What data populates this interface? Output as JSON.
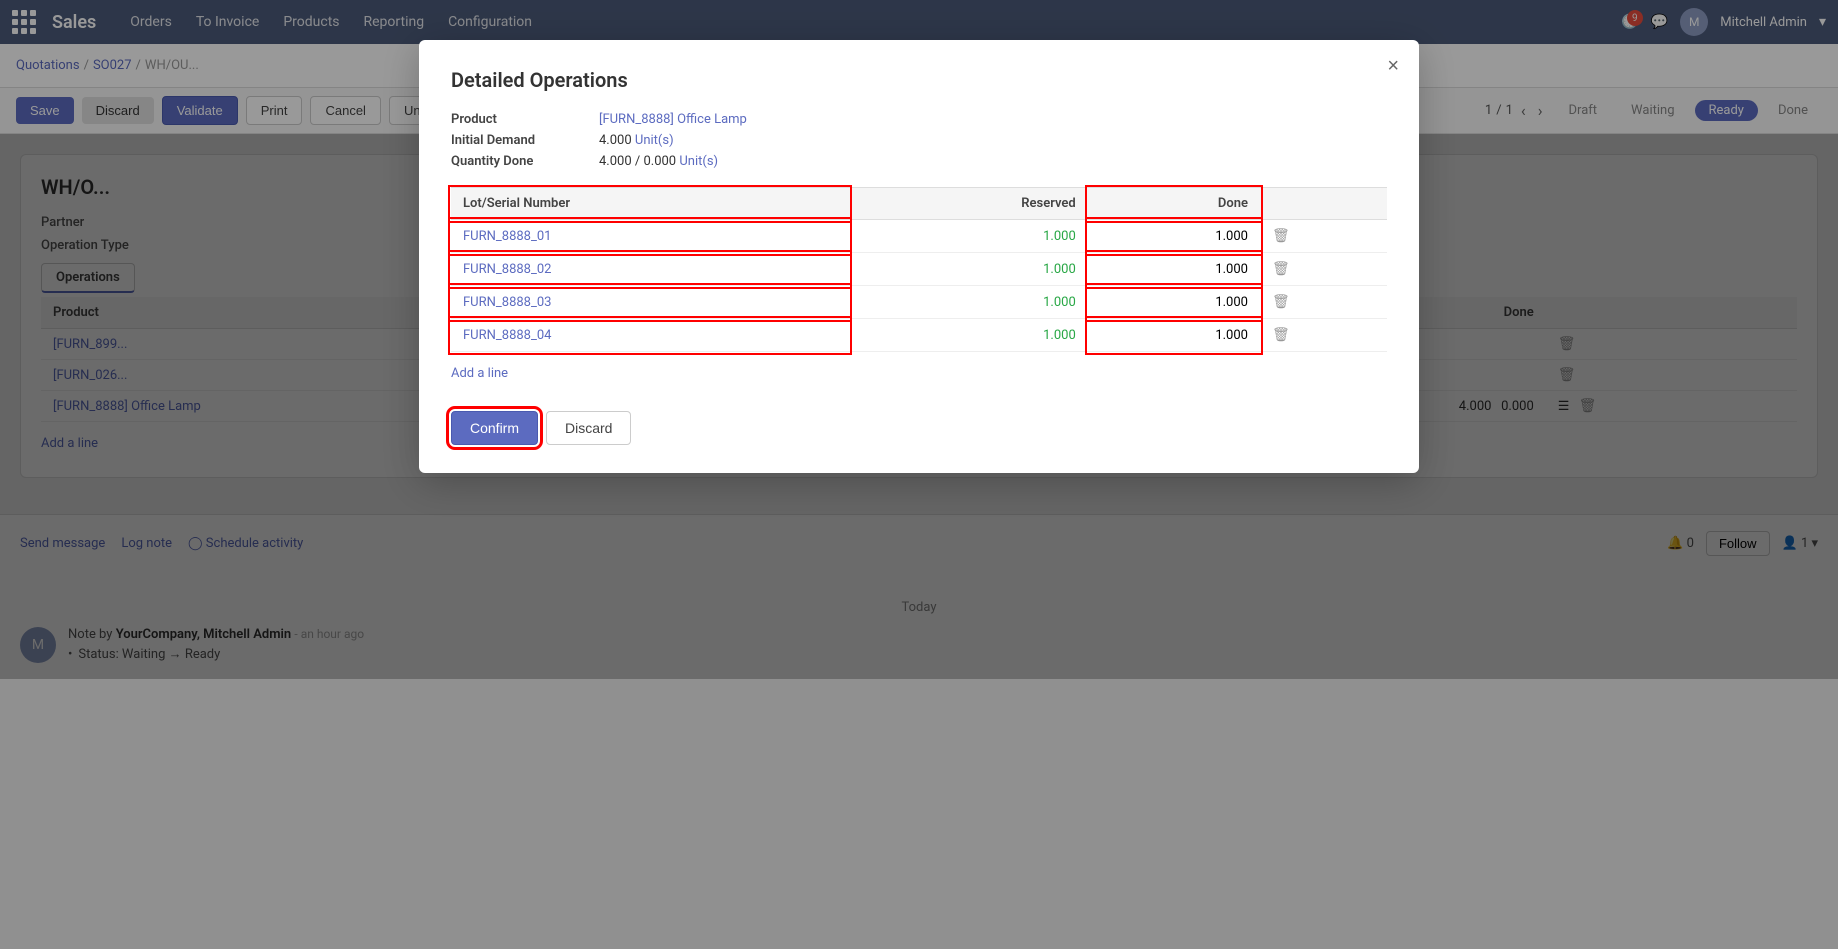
{
  "navbar": {
    "brand": "Sales",
    "menu_items": [
      "Orders",
      "To Invoice",
      "Products",
      "Reporting",
      "Configuration"
    ],
    "badge_count": "9",
    "user": "Mitchell Admin"
  },
  "breadcrumb": {
    "parts": [
      "Quotations",
      "SO027",
      "WH/OU..."
    ]
  },
  "action_bar": {
    "save_label": "Save",
    "discard_label": "Discard",
    "validate_label": "Validate",
    "print_label": "Print",
    "cancel_label": "Cancel",
    "unreserve_label": "Unreserve"
  },
  "page_nav": {
    "current": "1",
    "total": "1"
  },
  "status_items": [
    {
      "label": "Draft",
      "active": false
    },
    {
      "label": "Waiting",
      "active": false
    },
    {
      "label": "Ready",
      "active": true
    },
    {
      "label": "Done",
      "active": false
    }
  ],
  "content_title": "WH/O...",
  "form_fields": [
    {
      "label": "Partner",
      "value": ""
    },
    {
      "label": "Operation Type",
      "value": ""
    }
  ],
  "operations_tab": "Operations",
  "operations_table": {
    "headers": [
      "Product",
      "",
      "",
      "",
      "Done",
      ""
    ],
    "rows": [
      {
        "product": "[FURN_899...",
        "col2": "",
        "col3": "",
        "col4": "",
        "done": ""
      },
      {
        "product": "[FURN_026...",
        "col2": "",
        "col3": "",
        "col4": "",
        "done": ""
      },
      {
        "product": "[FURN_8888] Office Lamp",
        "col2": "",
        "col3": "",
        "col4": "4.000",
        "done": "4.000",
        "extra": "0.000"
      }
    ]
  },
  "add_line_label": "Add a line",
  "footer": {
    "send_message_label": "Send message",
    "log_note_label": "Log note",
    "schedule_activity_label": "Schedule activity",
    "follow_label": "Follow",
    "notifications_count": "0",
    "followers_count": "1"
  },
  "timeline": {
    "date_label": "Today",
    "entry": {
      "author": "YourCompany, Mitchell Admin",
      "time": "- an hour ago",
      "note_label": "Note by",
      "bullet": "Status: Waiting → Ready"
    }
  },
  "modal": {
    "title": "Detailed Operations",
    "close_label": "×",
    "product_label": "Product",
    "product_value": "[FURN_8888] Office Lamp",
    "initial_demand_label": "Initial Demand",
    "initial_demand_value": "4.000",
    "initial_demand_unit": "Unit(s)",
    "quantity_done_label": "Quantity Done",
    "quantity_done_value": "4.000 / 0.000",
    "quantity_done_unit": "Unit(s)",
    "table": {
      "col_lot": "Lot/Serial Number",
      "col_reserved": "Reserved",
      "col_done": "Done",
      "rows": [
        {
          "lot": "FURN_8888_01",
          "reserved": "1.000",
          "done": "1.000"
        },
        {
          "lot": "FURN_8888_02",
          "reserved": "1.000",
          "done": "1.000"
        },
        {
          "lot": "FURN_8888_03",
          "reserved": "1.000",
          "done": "1.000"
        },
        {
          "lot": "FURN_8888_04",
          "reserved": "1.000",
          "done": "1.000"
        }
      ]
    },
    "add_line_label": "Add a line",
    "confirm_label": "Confirm",
    "discard_label": "Discard"
  }
}
